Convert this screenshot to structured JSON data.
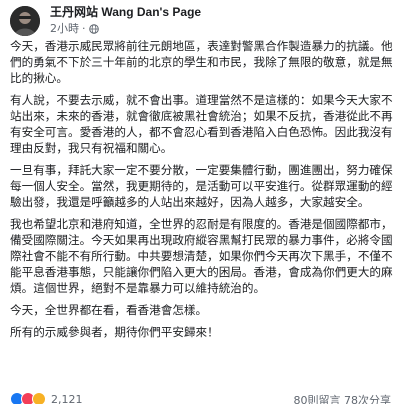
{
  "post": {
    "page_name": "王丹网站 Wang Dan's Page",
    "timestamp": "2小時",
    "separator": "·",
    "paragraphs": [
      "今天，香港示威民眾將前往元朗地區，表達對警黑合作製造暴力的抗議。他們的勇氣不下於三十年前的北京的學生和市民，我除了無限的敬意，就是無比的揪心。",
      "有人說，不要去示威，就不會出事。道理當然不是這樣的：如果今天大家不站出來，未來的香港，就會徹底被黑社會統治；如果不反抗，香港從此不再有安全可言。愛香港的人，都不會忍心看到香港陷入白色恐怖。因此我沒有理由反對，我只有祝福和關心。",
      "一旦有事，拜託大家一定不要分散，一定要集體行動，團進團出，努力確保每一個人安全。當然，我更期待的，是活動可以平安進行。從群眾運動的經驗出發，我還是呼籲越多的人站出來越好，因為人越多，大家越安全。",
      "我也希望北京和港府知道，全世界的忍耐是有限度的。香港是個國際都市，備受國際關注。今天如果再出現政府縱容黑幫打民眾的暴力事件，必將令國際社會不能不有所行動。中共要想清楚，如果你們今天再次下黑手，不僅不能平息香港事態，只能讓你們陷入更大的困局。香港，會成為你們更大的麻煩。這個世界，絕對不是靠暴力可以維持統治的。",
      "今天，全世界都在看，看香港會怎樣。",
      "所有的示威參與者，期待你們平安歸來！"
    ],
    "reaction_count": "2,121",
    "comments_shares": "80則留言 78次分享"
  }
}
